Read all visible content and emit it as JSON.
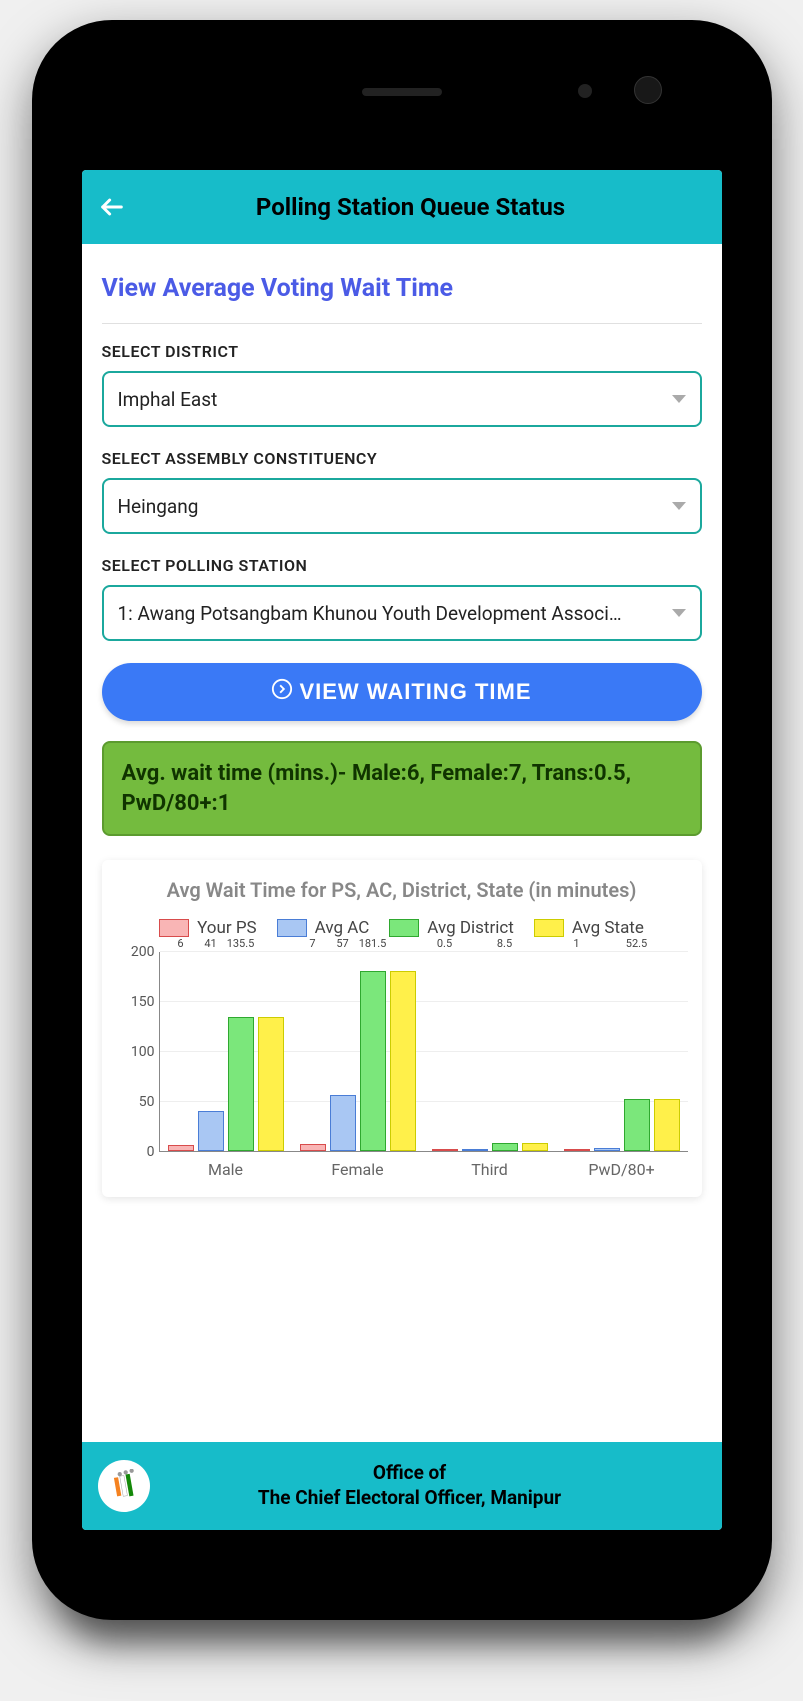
{
  "header": {
    "title": "Polling Station Queue Status"
  },
  "heading": "View Average Voting Wait Time",
  "fields": {
    "district": {
      "label": "SELECT DISTRICT",
      "value": "Imphal East"
    },
    "ac": {
      "label": "SELECT ASSEMBLY CONSTITUENCY",
      "value": "Heingang"
    },
    "ps": {
      "label": "SELECT POLLING STATION",
      "value": "1: Awang Potsangbam Khunou Youth Development Associ…"
    }
  },
  "button": {
    "label": "VIEW WAITING TIME"
  },
  "result": "Avg. wait time (mins.)- Male:6, Female:7, Trans:0.5, PwD/80+:1",
  "chart_data": {
    "type": "bar",
    "title": "Avg Wait Time for PS, AC, District, State (in minutes)",
    "categories": [
      "Male",
      "Female",
      "Third",
      "PwD/80+"
    ],
    "series": [
      {
        "name": "Your PS",
        "key": "ps",
        "values": [
          6,
          7,
          0.5,
          1
        ]
      },
      {
        "name": "Avg AC",
        "key": "ac",
        "values": [
          41,
          57,
          0.5,
          3
        ]
      },
      {
        "name": "Avg District",
        "key": "district",
        "values": [
          135.5,
          181.5,
          8.5,
          52.5
        ]
      },
      {
        "name": "Avg State",
        "key": "state",
        "values": [
          135.5,
          181.5,
          8.5,
          52.5
        ]
      }
    ],
    "data_labels": {
      "Male": {
        "ps": "6",
        "ac": "41",
        "district": "135.5"
      },
      "Female": {
        "ps": "7",
        "ac": "57",
        "district": "181.5"
      },
      "Third": {
        "ps": "0.5",
        "district": "8.5"
      },
      "PwD/80+": {
        "ps": "1",
        "district": "52.5"
      }
    },
    "ylabel": "",
    "xlabel": "",
    "ylim": [
      0,
      200
    ],
    "y_ticks": [
      0,
      50,
      100,
      150,
      200
    ]
  },
  "footer": {
    "line1": "Office of",
    "line2": "The Chief Electoral Officer, Manipur"
  }
}
